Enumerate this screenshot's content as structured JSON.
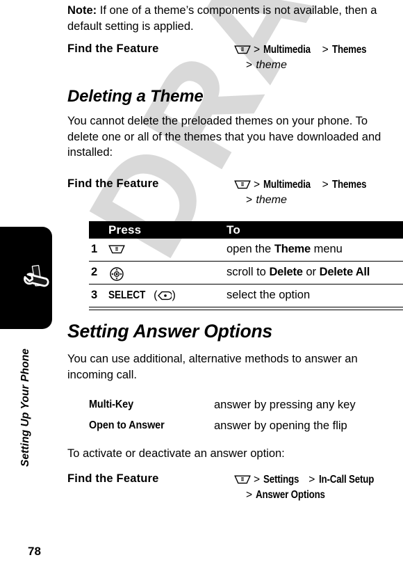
{
  "document": {
    "page_number": "78",
    "chapter_label": "Setting Up Your Phone",
    "watermark_text": "DRAFT"
  },
  "icons": {
    "menu_key": "menu-key-icon",
    "nav_key": "navigation-key-icon",
    "select_key": "select-key-icon",
    "chapter": "wrench-screwdriver-icon"
  },
  "note": {
    "label": "Note:",
    "text": " If one of a theme’s components is not available, then a default setting is applied."
  },
  "find_feature_1": {
    "label": "Find the Feature",
    "path_line1_a": "Multimedia",
    "path_line1_b": "Themes",
    "path_line2": "theme"
  },
  "heading_deleting": "Deleting a Theme",
  "paragraph_deleting": "You cannot delete the preloaded themes on your phone. To delete one or all of the themes that you have downloaded and installed:",
  "find_feature_2": {
    "label": "Find the Feature",
    "path_line1_a": "Multimedia",
    "path_line1_b": "Themes",
    "path_line2": "theme"
  },
  "steps_table": {
    "header": {
      "press": "Press",
      "to": "To"
    },
    "rows": [
      {
        "num": "1",
        "press_icon": "menu-key-icon",
        "press_text": "",
        "to_prefix": "open the ",
        "to_bold": "Theme",
        "to_suffix": " menu"
      },
      {
        "num": "2",
        "press_icon": "navigation-key-icon",
        "press_text": "",
        "to_prefix": "scroll to ",
        "to_bold": "Delete",
        "to_mid": " or ",
        "to_bold2": "Delete All",
        "to_suffix": ""
      },
      {
        "num": "3",
        "press_icon": "select-key-icon",
        "press_text": "SELECT",
        "to_prefix": "select the option",
        "to_bold": "",
        "to_suffix": ""
      }
    ]
  },
  "heading_answer_options": "Setting Answer Options",
  "paragraph_answer_options": "You can use additional, alternative methods to answer an incoming call.",
  "answer_options": [
    {
      "term": "Multi-Key",
      "definition": "answer by pressing any key"
    },
    {
      "term": "Open to Answer",
      "definition": "answer by opening the flip"
    }
  ],
  "paragraph_activate": "To activate or deactivate an answer option:",
  "find_feature_3": {
    "label": "Find the Feature",
    "path_line1_a": "Settings",
    "path_line1_b": "In-Call Setup",
    "path_line2": "Answer Options"
  }
}
